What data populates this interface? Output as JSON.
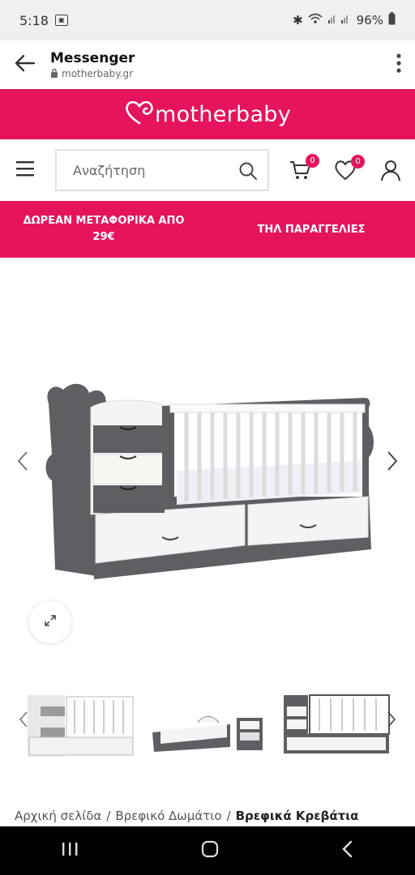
{
  "status": {
    "time": "5:18",
    "battery": "96%"
  },
  "browser": {
    "title": "Messenger",
    "url": "motherbaby.gr"
  },
  "logo": {
    "text": "motherbaby"
  },
  "search": {
    "placeholder": "Αναζήτηση"
  },
  "cart": {
    "count": "0"
  },
  "wishlist": {
    "count": "0"
  },
  "promo": {
    "left": "ΔΩΡΕΑΝ ΜΕΤΑΦΟΡΙΚΑ ΑΠΟ 29€",
    "right": "ΤΗΛ ΠΑΡΑΓΓΕΛΙΕΣ"
  },
  "breadcrumb": {
    "items": [
      "Αρχική σελίδα",
      "Βρεφικό Δωμάτιο",
      "Βρεφικά Κρεβάτια"
    ],
    "separator": "/"
  },
  "colors": {
    "brand": "#e5145c",
    "crib_gray": "#5f5f63",
    "crib_white": "#f4f4f4"
  }
}
